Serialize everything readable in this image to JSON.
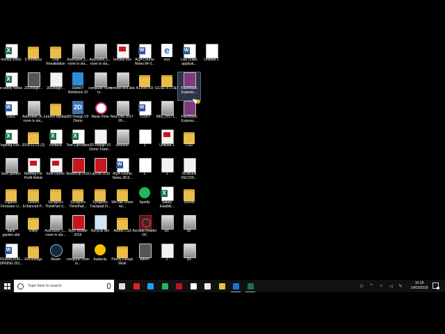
{
  "desktop": {
    "columns": [
      [
        {
          "label": "money check",
          "kind": "excel"
        },
        {
          "label": "e-safety Notes",
          "kind": "excel"
        },
        {
          "label": "Doc1",
          "kind": "word"
        },
        {
          "label": "Ingoing-Out...",
          "kind": "excel"
        },
        {
          "label": "back garden",
          "kind": "image"
        },
        {
          "label": "Digitizer Firmware U...",
          "kind": "folder"
        },
        {
          "label": "back garden.skb",
          "kind": "image"
        },
        {
          "label": "20180419140... SPRING 201...",
          "kind": "word"
        }
      ],
      [
        {
          "label": "5 Rothbury",
          "kind": "folder"
        },
        {
          "label": "2DDesign...",
          "kind": "app"
        },
        {
          "label": "AutoSave_A... room tv sta...",
          "kind": "image"
        },
        {
          "label": "2018-11-22 (2)",
          "kind": "folder"
        },
        {
          "label": "Renting For Profit Article",
          "kind": "pdf"
        },
        {
          "label": "Lenovo Enhanced P...",
          "kind": "folder"
        },
        {
          "label": "Utility",
          "kind": "folder"
        },
        {
          "label": "Recordings",
          "kind": "folder"
        }
      ],
      [
        {
          "label": "Lisa Revalidation",
          "kind": "folder"
        },
        {
          "label": "2DDesign...",
          "kind": "file"
        },
        {
          "label": "Lenovo backup",
          "kind": "folder"
        },
        {
          "label": "contacts",
          "kind": "excel"
        },
        {
          "label": "food course",
          "kind": "pdf"
        },
        {
          "label": "Synaptics ThinkPad U...",
          "kind": "folder"
        },
        {
          "label": "AutoSave_c... room tv sta...",
          "kind": "image"
        },
        {
          "label": "Steam",
          "kind": "steam"
        }
      ],
      [
        {
          "label": "AutoSave_c... room tv sta...",
          "kind": "image"
        },
        {
          "label": "SMART Notebook 10",
          "kind": "smart"
        },
        {
          "label": "2D Design V2 Demo",
          "kind": "2d"
        },
        {
          "label": "Test Calculator",
          "kind": "excel"
        },
        {
          "label": "SketchUp 2016",
          "kind": "sketchup"
        },
        {
          "label": "Synaptics ThinkPad...",
          "kind": "folder"
        },
        {
          "label": "Style Builder 2016",
          "kind": "sketchup"
        },
        {
          "label": "computer room tv...",
          "kind": "image"
        }
      ],
      [
        {
          "label": "AutoSave_c... room tv sta...",
          "kind": "image"
        },
        {
          "label": "computer room tv...",
          "kind": "image"
        },
        {
          "label": "Music Flow",
          "kind": "itunes"
        },
        {
          "label": "2D Design V2 Demo Tutori...",
          "kind": "file"
        },
        {
          "label": "LayOut 2016",
          "kind": "sketchup"
        },
        {
          "label": "Synaptics Trackpad Fi...",
          "kind": "folder"
        },
        {
          "label": "Recycle Bin",
          "kind": "recycle"
        },
        {
          "label": "Audacity",
          "kind": "audacity"
        }
      ],
      [
        {
          "label": "tortoise box",
          "kind": "pdf"
        },
        {
          "label": "tortoise box.skb",
          "kind": "image"
        },
        {
          "label": "New Doc 2017-05-...",
          "kind": "image"
        },
        {
          "label": "anteater",
          "kind": "image"
        },
        {
          "label": "AQA Course Notes 28 8...",
          "kind": "word"
        },
        {
          "label": "WinTab Driver for...",
          "kind": "folder"
        },
        {
          "label": "Adobe CS3",
          "kind": "folder"
        },
        {
          "label": "Peony Design Work",
          "kind": "folder"
        }
      ],
      [
        {
          "label": "AQA Course Notes 84 0...",
          "kind": "word"
        },
        {
          "label": "A Level KO",
          "kind": "folder"
        },
        {
          "label": "TODO",
          "kind": "word"
        },
        {
          "label": "1",
          "kind": "white"
        },
        {
          "label": "2",
          "kind": "white"
        },
        {
          "label": "Spotify",
          "kind": "spotify"
        },
        {
          "label": "Acrobat Reader DC",
          "kind": "acrobat"
        },
        {
          "label": "Adorn",
          "kind": "app"
        }
      ],
      [
        {
          "label": "test",
          "kind": "ie"
        },
        {
          "label": "GCSE 9-1 D&T",
          "kind": "folder"
        },
        {
          "label": "IMG_20171...",
          "kind": "image"
        },
        {
          "label": "Untitled-1",
          "kind": "pdf"
        },
        {
          "label": "1",
          "kind": "file"
        },
        {
          "label": "Salary feasibili...",
          "kind": "excel"
        },
        {
          "label": "p1",
          "kind": "image"
        },
        {
          "label": "2",
          "kind": "file"
        }
      ],
      [
        {
          "label": "Lisa Crane applicat...",
          "kind": "word"
        },
        {
          "label": "FlashBack Express...",
          "kind": "onenote",
          "selected": true
        },
        {
          "label": "FlashBack Express...",
          "kind": "onenote"
        },
        {
          "label": "CS3",
          "kind": "folder"
        },
        {
          "label": "SCREEN RECOR...",
          "kind": "file"
        },
        {
          "label": "School",
          "kind": "folder"
        },
        {
          "label": "p2",
          "kind": "image"
        },
        {
          "label": "p3",
          "kind": "image"
        }
      ],
      [
        {
          "label": "Untitled-1",
          "kind": "white"
        }
      ]
    ]
  },
  "taskbar": {
    "search_placeholder": "Type here to search",
    "pinned": [
      {
        "name": "task-view-icon",
        "color": "#dddddd"
      },
      {
        "name": "youtube-icon",
        "color": "#e02020"
      },
      {
        "name": "twitter-icon",
        "color": "#1da1f2"
      },
      {
        "name": "spotify-icon",
        "color": "#1db954"
      },
      {
        "name": "netflix-icon",
        "color": "#c11119"
      },
      {
        "name": "amazon-icon",
        "color": "#ffffff"
      },
      {
        "name": "mail-icon",
        "color": "#eeeeee"
      },
      {
        "name": "file-explorer-icon",
        "color": "#e9bd4a"
      },
      {
        "name": "edge-icon",
        "color": "#1a76d2",
        "active": true
      },
      {
        "name": "excel-icon",
        "color": "#1d7044",
        "active": true
      }
    ],
    "tray": [
      {
        "name": "people-icon",
        "glyph": "⚇"
      },
      {
        "name": "show-hidden-icons",
        "glyph": "^"
      },
      {
        "name": "network-icon",
        "glyph": "⌂"
      },
      {
        "name": "volume-icon",
        "glyph": "◁"
      },
      {
        "name": "pen-icon",
        "glyph": "✎"
      }
    ],
    "time": "10:18",
    "date": "14/03/2018"
  }
}
